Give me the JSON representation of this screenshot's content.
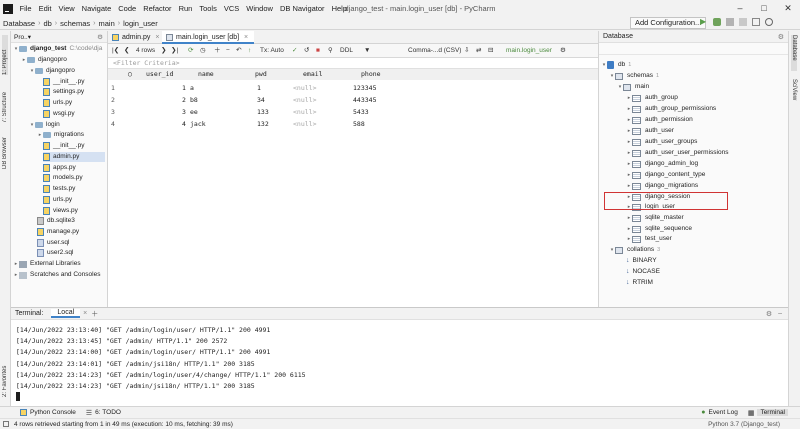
{
  "menubar": {
    "items": [
      "File",
      "Edit",
      "View",
      "Navigate",
      "Code",
      "Refactor",
      "Run",
      "Tools",
      "VCS",
      "Window",
      "DB Navigator",
      "Help"
    ],
    "window_title": "django_test - main.login_user [db] - PyCharm"
  },
  "navbar": {
    "crumbs": [
      "Database",
      "db",
      "schemas",
      "main",
      "login_user"
    ],
    "run_config": "Add Configuration..."
  },
  "left_strip": {
    "project": "1: Project",
    "structure": "7: Structure",
    "db_browser": "DB Browser",
    "favorites": "2: Favorites"
  },
  "right_strip": {
    "database": "Database",
    "sciview": "SciView"
  },
  "project": {
    "header": "Pro..▾",
    "items": [
      {
        "label": "django_test",
        "hint": "C:\\code\\dja",
        "bold": true
      },
      {
        "label": "djangopro"
      },
      {
        "label": "djangopro"
      },
      {
        "label": "__init__.py"
      },
      {
        "label": "settings.py"
      },
      {
        "label": "urls.py"
      },
      {
        "label": "wsgi.py"
      },
      {
        "label": "login"
      },
      {
        "label": "migrations"
      },
      {
        "label": "__init__.py"
      },
      {
        "label": "admin.py"
      },
      {
        "label": "apps.py"
      },
      {
        "label": "models.py"
      },
      {
        "label": "tests.py"
      },
      {
        "label": "urls.py"
      },
      {
        "label": "views.py"
      },
      {
        "label": "db.sqlite3"
      },
      {
        "label": "manage.py"
      },
      {
        "label": "user.sql"
      },
      {
        "label": "user2.sql"
      },
      {
        "label": "External Libraries"
      },
      {
        "label": "Scratches and Consoles"
      }
    ]
  },
  "editor": {
    "tabs": [
      {
        "label": "admin.py"
      },
      {
        "label": "main.login_user [db]"
      }
    ],
    "toolbar": {
      "rows_label": "4 rows",
      "tx_label": "Tx: Auto",
      "ddl_label": "DDL",
      "format_label": "Comma-...d (CSV)",
      "target_label": "main.login_user"
    },
    "filter_placeholder": "<Filter Criteria>",
    "columns": [
      "user_id",
      "name",
      "pwd",
      "email",
      "phone"
    ],
    "rows": [
      {
        "num": "1",
        "user_id": "1",
        "name": "a",
        "pwd": "1",
        "email": "<null>",
        "phone": "123345"
      },
      {
        "num": "2",
        "user_id": "2",
        "name": "b8",
        "pwd": "34",
        "email": "<null>",
        "phone": "443345"
      },
      {
        "num": "3",
        "user_id": "3",
        "name": "ee",
        "pwd": "133",
        "email": "<null>",
        "phone": "5433"
      },
      {
        "num": "4",
        "user_id": "4",
        "name": "jack",
        "pwd": "132",
        "email": "<null>",
        "phone": "588"
      }
    ]
  },
  "database": {
    "title": "Database",
    "db": {
      "label": "db",
      "count": "1"
    },
    "schemas": {
      "label": "schemas",
      "count": "1"
    },
    "main": {
      "label": "main"
    },
    "tables": [
      "auth_group",
      "auth_group_permissions",
      "auth_permission",
      "auth_user",
      "auth_user_groups",
      "auth_user_user_permissions",
      "django_admin_log",
      "django_content_type",
      "django_migrations",
      "django_session",
      "login_user",
      "sqlite_master",
      "sqlite_sequence",
      "test_user"
    ],
    "collations": {
      "label": "collations",
      "count": "3"
    },
    "collation_items": [
      "BINARY",
      "NOCASE",
      "RTRIM"
    ]
  },
  "terminal": {
    "title": "Terminal:",
    "tab": "Local",
    "lines": [
      "[14/Jun/2022 23:13:40] \"GET /admin/login/user/ HTTP/1.1\" 200 4991",
      "[14/Jun/2022 23:13:45] \"GET /admin/ HTTP/1.1\" 200 2572",
      "[14/Jun/2022 23:14:00] \"GET /admin/login/user/ HTTP/1.1\" 200 4991",
      "[14/Jun/2022 23:14:01] \"GET /admin/jsi18n/ HTTP/1.1\" 200 3185",
      "[14/Jun/2022 23:14:23] \"GET /admin/login/user/4/change/ HTTP/1.1\" 200 6115",
      "[14/Jun/2022 23:14:23] \"GET /admin/jsi18n/ HTTP/1.1\" 200 3185"
    ]
  },
  "toolwindows": {
    "python_console": "Python Console",
    "todo": "6: TODO",
    "event_log": "Event Log",
    "terminal": "Terminal"
  },
  "status": {
    "message": "4 rows retrieved starting from 1 in 49 ms (execution: 10 ms, fetching: 39 ms)",
    "interpreter": "Python 3.7 (Django_test)"
  }
}
